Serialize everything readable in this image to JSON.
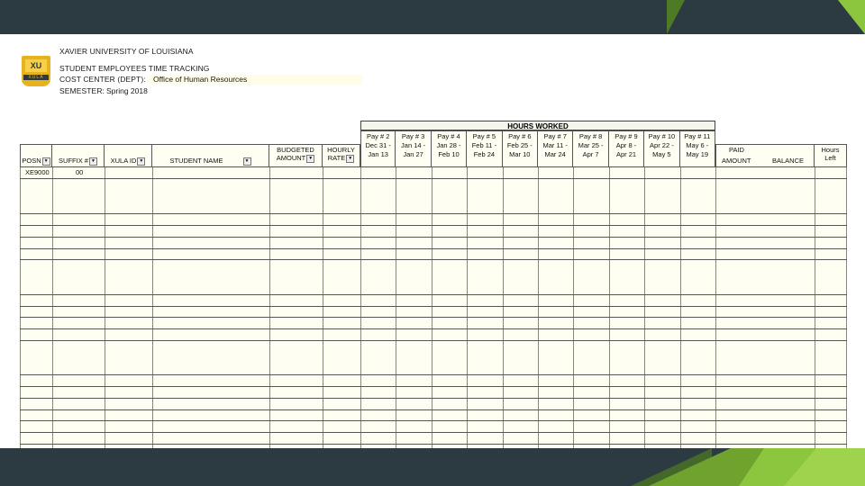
{
  "header": {
    "university": "XAVIER UNIVERSITY OF LOUISIANA",
    "subtitle": "STUDENT EMPLOYEES TIME TRACKING",
    "cost_center_label": "COST CENTER (DEPT):",
    "cost_center_value": "Office of Human Resources",
    "semester_label": "SEMESTER:",
    "semester_value": "Spring 2018",
    "logo_text": "XU",
    "logo_band": "XULA"
  },
  "hours_worked_label": "HOURS WORKED",
  "columns": {
    "posn": "POSN",
    "suffix": "SUFFIX #",
    "xula_id": "XULA ID",
    "student_name": "STUDENT NAME",
    "budgeted_1": "BUDGETED",
    "budgeted_2": "AMOUNT",
    "hourly_1": "HOURLY",
    "hourly_2": "RATE",
    "paid_1": "PAID",
    "paid_2": "AMOUNT",
    "balance": "BALANCE",
    "hours_1": "Hours",
    "hours_2": "Left"
  },
  "pay_periods": [
    {
      "pay": "Pay # 2",
      "range1": "Dec 31 -",
      "range2": "Jan 13"
    },
    {
      "pay": "Pay # 3",
      "range1": "Jan 14 -",
      "range2": "Jan 27"
    },
    {
      "pay": "Pay # 4",
      "range1": "Jan 28 -",
      "range2": "Feb 10"
    },
    {
      "pay": "Pay # 5",
      "range1": "Feb 11 -",
      "range2": "Feb 24"
    },
    {
      "pay": "Pay # 6",
      "range1": "Feb 25 -",
      "range2": "Mar 10"
    },
    {
      "pay": "Pay # 7",
      "range1": "Mar 11 -",
      "range2": "Mar 24"
    },
    {
      "pay": "Pay # 8",
      "range1": "Mar 25 -",
      "range2": "Apr 7"
    },
    {
      "pay": "Pay # 9",
      "range1": "Apr 8 -",
      "range2": "Apr 21"
    },
    {
      "pay": "Pay # 10",
      "range1": "Apr 22 -",
      "range2": "May 5"
    },
    {
      "pay": "Pay # 11",
      "range1": "May 6 -",
      "range2": "May 19"
    }
  ],
  "first_row": {
    "posn": "XE9000",
    "suffix": "00"
  },
  "filter_glyph": "▼",
  "colors": {
    "dark_bar": "#2c3a42",
    "green_light": "#8cc63f",
    "green_dark": "#5a8f1e",
    "sheet_fill": "#fffef2"
  }
}
